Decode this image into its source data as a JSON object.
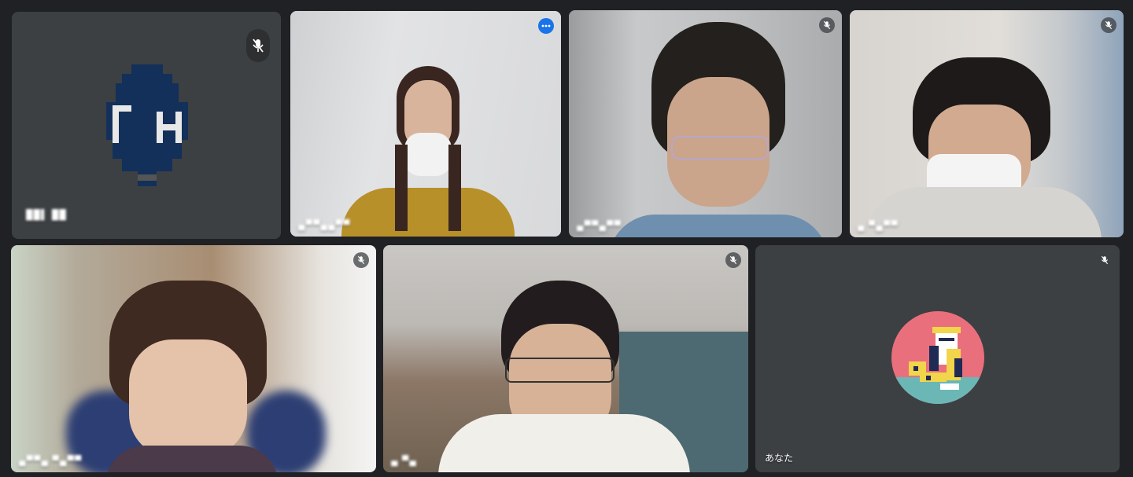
{
  "app": {
    "theme_color": "#202124",
    "accent": "#1a73e8"
  },
  "participants": [
    {
      "name": "██▌ ██",
      "muted": true,
      "video_on": false,
      "avatar": "pixel-avatar-navy"
    },
    {
      "name": "▄▀▀▄▄▀▀",
      "muted": false,
      "video_on": true,
      "highlighted": true
    },
    {
      "name": "▄▀▀▄▀▀",
      "muted": true,
      "video_on": true
    },
    {
      "name": "▄ ▀▄▀▀",
      "muted": true,
      "video_on": true
    },
    {
      "name": "▄▀▀▄ ▀▄▀▀",
      "muted": true,
      "video_on": true
    },
    {
      "name": "▄ ▀▄",
      "muted": true,
      "video_on": true
    },
    {
      "name": "あなた",
      "muted": true,
      "video_on": false,
      "avatar": "pixel-avatar-pink"
    }
  ],
  "icons": {
    "mic_off": "mic-off-icon",
    "more": "more-options-icon"
  }
}
